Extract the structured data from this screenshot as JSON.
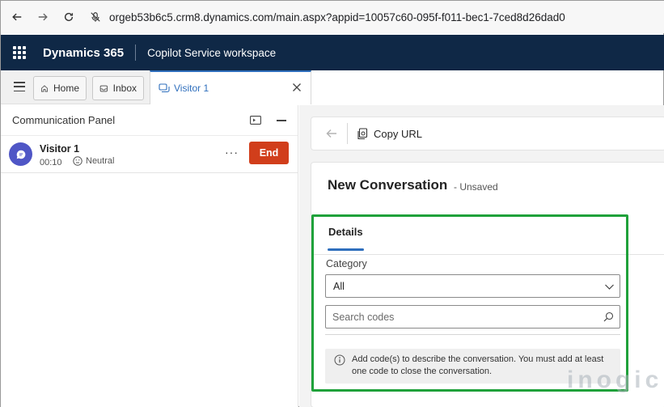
{
  "browser": {
    "url": "orgeb53b6c5.crm8.dynamics.com/main.aspx?appid=10057c60-095f-f011-bec1-7ced8d26dad0"
  },
  "header": {
    "app_name": "Dynamics 365",
    "workspace": "Copilot Service workspace",
    "bg_color": "#0f2846"
  },
  "tabs": {
    "home": "Home",
    "inbox": "Inbox",
    "visitor": "Visitor 1"
  },
  "comm_panel": {
    "title": "Communication Panel",
    "session": {
      "name": "Visitor 1",
      "time": "00:10",
      "sentiment": "Neutral",
      "more": "···",
      "end_label": "End",
      "end_color": "#d13e1b"
    }
  },
  "commands": {
    "copy_url": "Copy URL"
  },
  "form": {
    "title": "New Conversation",
    "status": "- Unsaved",
    "tab_details": "Details",
    "category_label": "Category",
    "category_value": "All",
    "search_placeholder": "Search codes",
    "info_text": "Add code(s) to describe the conversation. You must add at least one code to close the conversation."
  },
  "watermark": "inogic"
}
